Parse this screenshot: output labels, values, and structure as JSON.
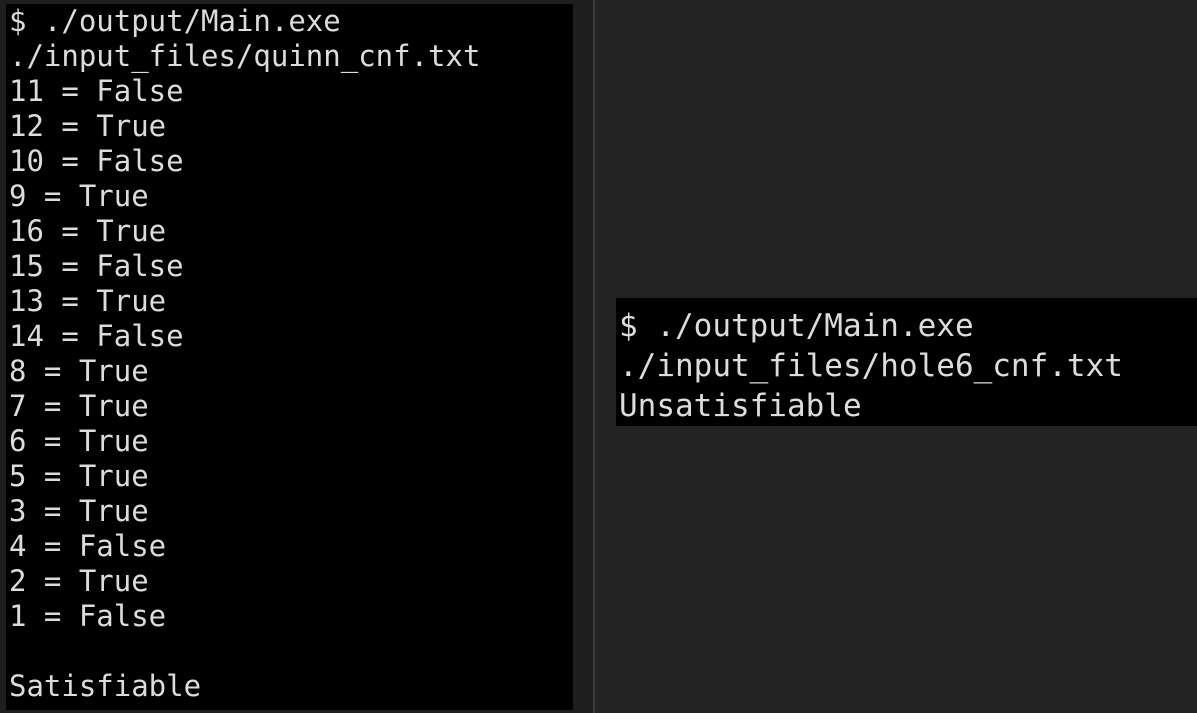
{
  "left_terminal": {
    "command": "$ ./output/Main.exe",
    "input_file": "./input_files/quinn_cnf.txt",
    "assignments": [
      "11 = False",
      "12 = True",
      "10 = False",
      "9 = True",
      "16 = True",
      "15 = False",
      "13 = True",
      "14 = False",
      "8 = True",
      "7 = True",
      "6 = True",
      "5 = True",
      "3 = True",
      "4 = False",
      "2 = True",
      "1 = False"
    ],
    "blank": "",
    "result": "Satisfiable"
  },
  "right_terminal": {
    "command": "$ ./output/Main.exe",
    "input_file": "./input_files/hole6_cnf.txt",
    "result": "Unsatisfiable"
  },
  "colors": {
    "terminal_bg": "#000000",
    "terminal_text": "#dcdcdc",
    "window_bg": "#232323"
  }
}
